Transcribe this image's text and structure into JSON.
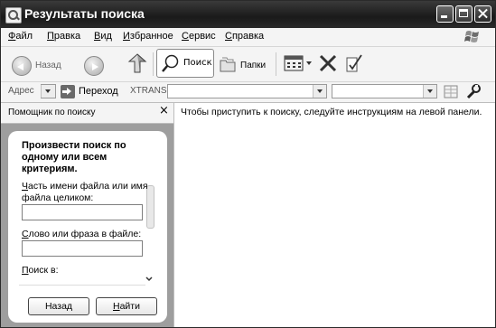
{
  "window": {
    "title": "Результаты поиска"
  },
  "menu": [
    {
      "u": "Ф",
      "rest": "айл"
    },
    {
      "u": "П",
      "rest": "равка"
    },
    {
      "u": "В",
      "rest": "ид"
    },
    {
      "u": "И",
      "rest": "збранное"
    },
    {
      "u": "С",
      "rest": "ервис"
    },
    {
      "u": "С",
      "rest": "правка"
    }
  ],
  "toolbar": {
    "back_label": "Назад",
    "search_label": "Поиск",
    "folders_label": "Папки"
  },
  "address": {
    "label": "Адрес",
    "go_label": "Переход",
    "links_label": "XTRANS"
  },
  "assistant": {
    "pane_title": "Помощник по поиску",
    "close_glyph": "×",
    "heading": "Произвести поиск по одному или всем критериям.",
    "filename_label_u": "Ч",
    "filename_label_rest": "асть имени файла или имя файла целиком:",
    "filename_value": "",
    "phrase_label_u": "С",
    "phrase_label_rest": "лово или фраза в файле:",
    "phrase_value": "",
    "lookin_label_u": "П",
    "lookin_label_rest": "оиск в:",
    "back_button": "Назад",
    "find_button_u": "Н",
    "find_button_rest": "айти"
  },
  "main": {
    "hint": "Чтобы приступить к поиску, следуйте инструкциям на левой панели."
  }
}
